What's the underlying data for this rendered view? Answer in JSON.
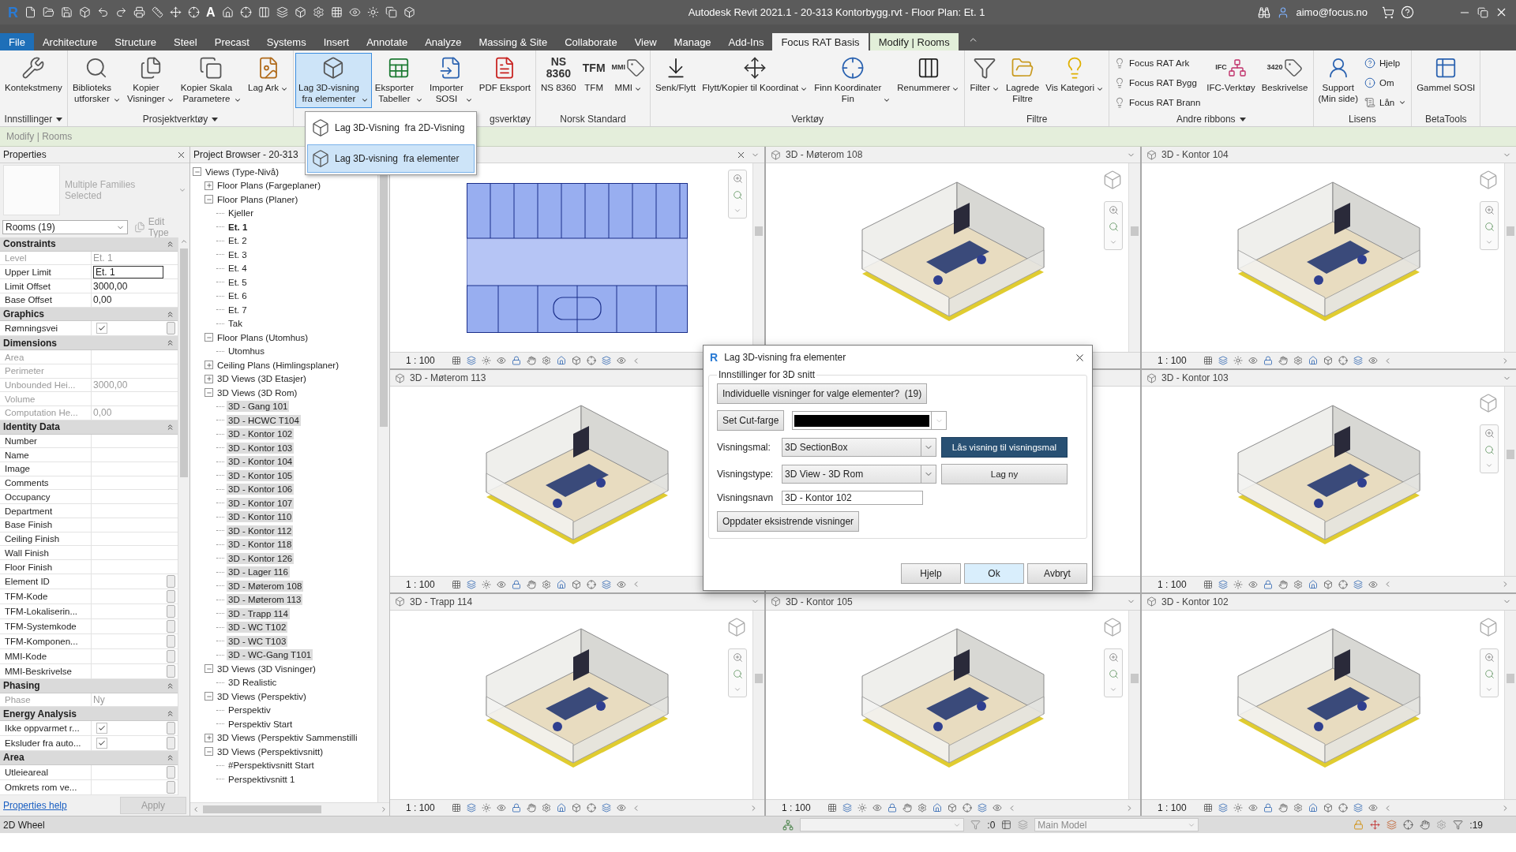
{
  "title_bar": {
    "logo": "R",
    "text_tool_glyph": "A",
    "title": "Autodesk Revit 2021.1 - 20-313 Kontorbygg.rvt - Floor Plan: Et. 1",
    "user": "aimo@focus.no"
  },
  "menu_tabs": [
    {
      "label": "File",
      "kind": "file",
      "selected": false
    },
    {
      "label": "Architecture",
      "kind": "tab",
      "selected": false
    },
    {
      "label": "Structure",
      "kind": "tab",
      "selected": false
    },
    {
      "label": "Steel",
      "kind": "tab",
      "selected": false
    },
    {
      "label": "Precast",
      "kind": "tab",
      "selected": false
    },
    {
      "label": "Systems",
      "kind": "tab",
      "selected": false
    },
    {
      "label": "Insert",
      "kind": "tab",
      "selected": false
    },
    {
      "label": "Annotate",
      "kind": "tab",
      "selected": false
    },
    {
      "label": "Analyze",
      "kind": "tab",
      "selected": false
    },
    {
      "label": "Massing & Site",
      "kind": "tab",
      "selected": false
    },
    {
      "label": "Collaborate",
      "kind": "tab",
      "selected": false
    },
    {
      "label": "View",
      "kind": "tab",
      "selected": false
    },
    {
      "label": "Manage",
      "kind": "tab",
      "selected": false
    },
    {
      "label": "Add-Ins",
      "kind": "tab",
      "selected": false
    },
    {
      "label": "Focus RAT Basis",
      "kind": "tab",
      "selected": true
    },
    {
      "label": "Modify | Rooms",
      "kind": "contextual",
      "selected": false
    }
  ],
  "ribbon_panels": [
    {
      "title": "Innstillinger",
      "menu": true,
      "buttons": [
        {
          "kind": "large",
          "label": "Kontekstmeny",
          "dropdown": false,
          "pressed": false
        }
      ]
    },
    {
      "title": "Prosjektverktøy",
      "menu": true,
      "buttons": [
        {
          "kind": "large",
          "label": "Biblioteks\nutforsker",
          "dropdown": true,
          "pressed": false
        },
        {
          "kind": "large",
          "label": "Kopier\nVisninger",
          "dropdown": true,
          "pressed": false
        },
        {
          "kind": "large",
          "label": "Kopier Skala\nParametere",
          "dropdown": true,
          "pressed": false
        },
        {
          "kind": "large",
          "label": "Lag Ark",
          "dropdown": true,
          "pressed": false
        }
      ]
    },
    {
      "title": "gsverktøy",
      "menu": false,
      "buttons": [
        {
          "kind": "large",
          "label": "Lag 3D-visning\nfra elementer",
          "dropdown": true,
          "pressed": true
        },
        {
          "kind": "large",
          "label": "Eksporter\nTabeller",
          "dropdown": true,
          "pressed": false
        },
        {
          "kind": "large",
          "label": "Importer\nSOSI",
          "dropdown": true,
          "pressed": false
        },
        {
          "kind": "large",
          "label": "PDF Eksport",
          "dropdown": false,
          "pressed": false
        }
      ]
    },
    {
      "title": "Norsk Standard",
      "menu": false,
      "buttons": [
        {
          "kind": "text_icon",
          "icon_text": "NS\n8360",
          "label": "NS 8360",
          "dropdown": false,
          "pressed": false
        },
        {
          "kind": "text_icon",
          "icon_text": "TFM",
          "label": "TFM",
          "dropdown": false,
          "pressed": false
        },
        {
          "kind": "large",
          "icon_text": "MMI",
          "label": "MMI",
          "dropdown": true,
          "pressed": false
        }
      ]
    },
    {
      "title": "Verktøy",
      "menu": false,
      "buttons": [
        {
          "kind": "large",
          "label": "Senk/Flytt",
          "dropdown": false,
          "pressed": false
        },
        {
          "kind": "large",
          "label": "Flytt/Kopier til Koordinat",
          "dropdown": true,
          "pressed": false
        },
        {
          "kind": "large",
          "label": "Finn Koordinater\nFin",
          "dropdown": true,
          "pressed": false
        },
        {
          "kind": "large",
          "label": "Renummerer",
          "dropdown": true,
          "pressed": false
        }
      ]
    },
    {
      "title": "Filtre",
      "menu": false,
      "buttons": [
        {
          "kind": "large",
          "label": "Filter",
          "dropdown": true,
          "pressed": false
        },
        {
          "kind": "large",
          "label": "Lagrede\nFiltre",
          "dropdown": false,
          "pressed": false
        },
        {
          "kind": "large",
          "label": "Vis Kategori",
          "dropdown": true,
          "pressed": false
        }
      ]
    },
    {
      "title": "Andre ribbons",
      "menu": true,
      "buttons": [
        {
          "kind": "small",
          "label": "Focus RAT Ark",
          "dropdown": false,
          "pressed": false
        },
        {
          "kind": "small",
          "label": "Focus RAT Bygg",
          "dropdown": false,
          "pressed": false
        },
        {
          "kind": "small",
          "label": "Focus RAT Brann",
          "dropdown": false,
          "pressed": false
        },
        {
          "kind": "large",
          "icon_text": "IFC",
          "label": "IFC-Verktøy",
          "dropdown": false,
          "pressed": false
        },
        {
          "kind": "large",
          "icon_text": "3420",
          "label": "Beskrivelse",
          "dropdown": false,
          "pressed": false
        }
      ]
    },
    {
      "title": "Lisens",
      "menu": false,
      "buttons": [
        {
          "kind": "large",
          "label": "Support\n(Min side)",
          "dropdown": false,
          "pressed": false
        },
        {
          "kind": "small",
          "label": "Hjelp",
          "dropdown": false,
          "pressed": false
        },
        {
          "kind": "small",
          "label": "Om",
          "dropdown": false,
          "pressed": false
        },
        {
          "kind": "small",
          "label": "Lån",
          "dropdown": true,
          "pressed": false
        }
      ]
    },
    {
      "title": "BetaTools",
      "menu": false,
      "buttons": [
        {
          "kind": "large",
          "label": "Gammel SOSI",
          "dropdown": false,
          "pressed": false
        }
      ]
    }
  ],
  "ribbon_menu": [
    {
      "label": "Lag 3D-Visning  fra 2D-Visning",
      "selected": false
    },
    {
      "label": "Lag 3D-visning  fra elementer",
      "selected": true
    }
  ],
  "options_bar": {
    "label": "Modify | Rooms"
  },
  "properties": {
    "title": "Properties",
    "type_name": "Multiple Families Selected",
    "filter": "Rooms (19)",
    "edit_type": "Edit Type",
    "help_link": "Properties help",
    "apply": "Apply",
    "groups": [
      {
        "title": "Constraints",
        "expanded": true,
        "rows": [
          {
            "label": "Level",
            "value": "Et. 1",
            "kind": "text",
            "disabled": true,
            "side_button": false
          },
          {
            "label": "Upper Limit",
            "value": "Et. 1",
            "kind": "input",
            "disabled": false,
            "side_button": false
          },
          {
            "label": "Limit Offset",
            "value": "3000,00",
            "kind": "text",
            "disabled": false,
            "side_button": false
          },
          {
            "label": "Base Offset",
            "value": "0,00",
            "kind": "text",
            "disabled": false,
            "side_button": false
          }
        ]
      },
      {
        "title": "Graphics",
        "expanded": true,
        "rows": [
          {
            "label": "Rømningsvei",
            "kind": "checkbox",
            "checked": true,
            "disabled": false,
            "side_button": true
          }
        ]
      },
      {
        "title": "Dimensions",
        "expanded": true,
        "rows": [
          {
            "label": "Area",
            "kind": "text",
            "disabled": true,
            "side_button": false
          },
          {
            "label": "Perimeter",
            "kind": "text",
            "disabled": true,
            "side_button": false
          },
          {
            "label": "Unbounded Hei...",
            "value": "3000,00",
            "kind": "text",
            "disabled": true,
            "side_button": false
          },
          {
            "label": "Volume",
            "kind": "text",
            "disabled": true,
            "side_button": false
          },
          {
            "label": "Computation He...",
            "value": "0,00",
            "kind": "text",
            "disabled": true,
            "side_button": false
          }
        ]
      },
      {
        "title": "Identity Data",
        "expanded": true,
        "rows": [
          {
            "label": "Number",
            "kind": "text",
            "disabled": false,
            "side_button": false
          },
          {
            "label": "Name",
            "kind": "text",
            "disabled": false,
            "side_button": false
          },
          {
            "label": "Image",
            "kind": "text",
            "disabled": false,
            "side_button": false
          },
          {
            "label": "Comments",
            "kind": "text",
            "disabled": false,
            "side_button": false
          },
          {
            "label": "Occupancy",
            "kind": "text",
            "disabled": false,
            "side_button": false
          },
          {
            "label": "Department",
            "kind": "text",
            "disabled": false,
            "side_button": false
          },
          {
            "label": "Base Finish",
            "kind": "text",
            "disabled": false,
            "side_button": false
          },
          {
            "label": "Ceiling Finish",
            "kind": "text",
            "disabled": false,
            "side_button": false
          },
          {
            "label": "Wall Finish",
            "kind": "text",
            "disabled": false,
            "side_button": false
          },
          {
            "label": "Floor Finish",
            "kind": "text",
            "disabled": false,
            "side_button": false
          },
          {
            "label": "Element ID",
            "kind": "text",
            "disabled": false,
            "side_button": true
          },
          {
            "label": "TFM-Kode",
            "kind": "text",
            "disabled": false,
            "side_button": true
          },
          {
            "label": "TFM-Lokaliserin...",
            "kind": "text",
            "disabled": false,
            "side_button": true
          },
          {
            "label": "TFM-Systemkode",
            "kind": "text",
            "disabled": false,
            "side_button": true
          },
          {
            "label": "TFM-Komponen...",
            "kind": "text",
            "disabled": false,
            "side_button": true
          },
          {
            "label": "MMI-Kode",
            "kind": "text",
            "disabled": false,
            "side_button": true
          },
          {
            "label": "MMI-Beskrivelse",
            "kind": "text",
            "disabled": false,
            "side_button": true
          }
        ]
      },
      {
        "title": "Phasing",
        "expanded": true,
        "rows": [
          {
            "label": "Phase",
            "value": "Ny",
            "kind": "text",
            "disabled": true,
            "side_button": false
          }
        ]
      },
      {
        "title": "Energy Analysis",
        "expanded": true,
        "rows": [
          {
            "label": "Ikke oppvarmet r...",
            "kind": "checkbox",
            "checked": true,
            "disabled": false,
            "side_button": true
          },
          {
            "label": "Eksluder fra auto...",
            "kind": "checkbox",
            "checked": true,
            "disabled": false,
            "side_button": true
          }
        ]
      },
      {
        "title": "Area",
        "expanded": true,
        "rows": [
          {
            "label": "Utleieareal",
            "kind": "text",
            "disabled": false,
            "side_button": true
          },
          {
            "label": "Omkrets rom ve...",
            "kind": "text",
            "disabled": false,
            "side_button": true
          }
        ]
      }
    ]
  },
  "browser": {
    "title": "Project Browser - 20-313",
    "tree": {
      "label": "Views (Type-Nivå)",
      "expanded": true,
      "children": [
        {
          "label": "Floor Plans (Fargeplaner)",
          "expanded": false
        },
        {
          "label": "Floor Plans (Planer)",
          "expanded": true,
          "children": [
            {
              "label": "Kjeller",
              "selected": false,
              "current": false
            },
            {
              "label": "Et. 1",
              "selected": false,
              "current": true
            },
            {
              "label": "Et. 2",
              "selected": false,
              "current": false
            },
            {
              "label": "Et. 3",
              "selected": false,
              "current": false
            },
            {
              "label": "Et. 4",
              "selected": false,
              "current": false
            },
            {
              "label": "Et. 5",
              "selected": false,
              "current": false
            },
            {
              "label": "Et. 6",
              "selected": false,
              "current": false
            },
            {
              "label": "Et. 7",
              "selected": false,
              "current": false
            },
            {
              "label": "Tak",
              "selected": false,
              "current": false
            }
          ]
        },
        {
          "label": "Floor Plans (Utomhus)",
          "expanded": true,
          "children": [
            {
              "label": "Utomhus",
              "selected": false,
              "current": false
            }
          ]
        },
        {
          "label": "Ceiling Plans (Himlingsplaner)",
          "expanded": false
        },
        {
          "label": "3D Views (3D Etasjer)",
          "expanded": false
        },
        {
          "label": "3D Views (3D Rom)",
          "expanded": true,
          "children": [
            {
              "label": "3D - Gang 101",
              "selected": true,
              "current": false
            },
            {
              "label": "3D - HCWC T104",
              "selected": true,
              "current": false
            },
            {
              "label": "3D - Kontor 102",
              "selected": true,
              "current": false
            },
            {
              "label": "3D - Kontor 103",
              "selected": true,
              "current": false
            },
            {
              "label": "3D - Kontor 104",
              "selected": true,
              "current": false
            },
            {
              "label": "3D - Kontor 105",
              "selected": true,
              "current": false
            },
            {
              "label": "3D - Kontor 106",
              "selected": true,
              "current": false
            },
            {
              "label": "3D - Kontor 107",
              "selected": true,
              "current": false
            },
            {
              "label": "3D - Kontor 110",
              "selected": true,
              "current": false
            },
            {
              "label": "3D - Kontor 112",
              "selected": true,
              "current": false
            },
            {
              "label": "3D - Kontor 118",
              "selected": true,
              "current": false
            },
            {
              "label": "3D - Kontor 126",
              "selected": true,
              "current": false
            },
            {
              "label": "3D - Lager 116",
              "selected": true,
              "current": false
            },
            {
              "label": "3D - Møterom 108",
              "selected": true,
              "current": false
            },
            {
              "label": "3D - Møterom 113",
              "selected": true,
              "current": false
            },
            {
              "label": "3D - Trapp 114",
              "selected": true,
              "current": false
            },
            {
              "label": "3D - WC T102",
              "selected": true,
              "current": false
            },
            {
              "label": "3D - WC T103",
              "selected": true,
              "current": false
            },
            {
              "label": "3D - WC-Gang T101",
              "selected": true,
              "current": false
            }
          ]
        },
        {
          "label": "3D Views (3D Visninger)",
          "expanded": true,
          "children": [
            {
              "label": "3D Realistic",
              "selected": false,
              "current": false
            }
          ]
        },
        {
          "label": "3D Views (Perspektiv)",
          "expanded": true,
          "children": [
            {
              "label": "Perspektiv",
              "selected": false,
              "current": false
            },
            {
              "label": "Perspektiv Start",
              "selected": false,
              "current": false
            }
          ]
        },
        {
          "label": "3D Views (Perspektiv Sammenstilli",
          "expanded": false
        },
        {
          "label": "3D Views (Perspektivsnitt)",
          "expanded": true,
          "children": [
            {
              "label": "#Perspektivsnitt Start",
              "selected": false,
              "current": false
            },
            {
              "label": "Perspektivsnitt 1",
              "selected": false,
              "current": false
            }
          ]
        }
      ]
    }
  },
  "views": [
    {
      "kind": "plan",
      "scale": "1 : 100"
    },
    {
      "kind": "model",
      "title": "3D - Møterom 108"
    },
    {
      "kind": "model",
      "title": "3D - Kontor 104",
      "scale": "1 : 100"
    },
    {
      "kind": "model",
      "title": "3D - Møterom 113",
      "scale": "1 : 100"
    },
    {
      "kind": "covered"
    },
    {
      "kind": "model",
      "title": "3D - Kontor 103",
      "scale": "1 : 100"
    },
    {
      "kind": "model",
      "title": "3D - Trapp 114",
      "scale": "1 : 100"
    },
    {
      "kind": "model",
      "title": "3D - Kontor 105",
      "scale": "1 : 100"
    },
    {
      "kind": "model",
      "title": "3D - Kontor 102",
      "scale": "1 : 100"
    }
  ],
  "dialog": {
    "logo": "R",
    "title": "Lag 3D-visning fra elementer",
    "group": "Innstillinger for 3D snitt",
    "individual_button": "Individuelle visninger for valge elementer?  (19)",
    "cut_color_button": "Set Cut-farge",
    "rows": [
      {
        "label": "Visningsmal:",
        "value": "3D SectionBox",
        "button": "Lås visning til visningsmal",
        "highlighted": true
      },
      {
        "label": "Visningstype:",
        "value": "3D View - 3D Rom",
        "button": "Lag ny",
        "highlighted": false
      }
    ],
    "name_label": "Visningsnavn",
    "name_value": "3D - Kontor 102",
    "update_button": "Oppdater eksistrende visninger",
    "footer": [
      {
        "label": "Hjelp",
        "focused": false
      },
      {
        "label": "Ok",
        "focused": true
      },
      {
        "label": "Avbryt",
        "focused": false
      }
    ]
  },
  "status_bar": {
    "hint": "2D Wheel",
    "filter_count": ":0",
    "model": "Main Model",
    "selection_count": ":19"
  }
}
